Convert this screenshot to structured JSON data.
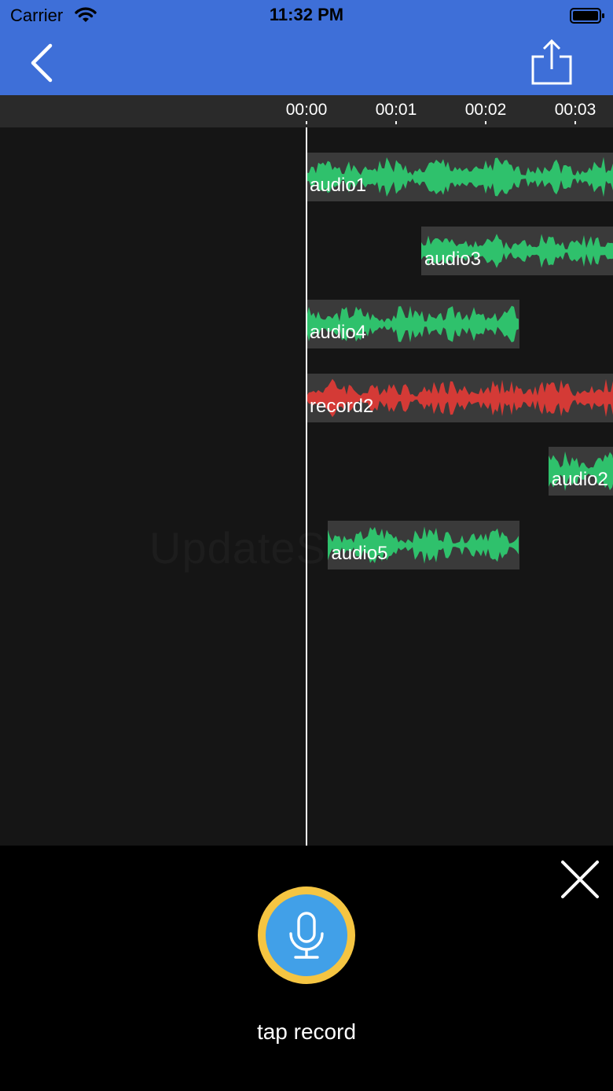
{
  "status_bar": {
    "carrier": "Carrier",
    "time": "11:32 PM",
    "wifi_icon": "wifi-icon",
    "battery_icon": "battery-icon"
  },
  "nav": {
    "back_icon": "chevron-left-icon",
    "share_icon": "share-icon",
    "background_color": "#3e6fd8"
  },
  "ruler": {
    "labels": [
      "00:00",
      "00:01",
      "00:02",
      "00:03"
    ]
  },
  "tracks": [
    {
      "label": "audio1",
      "color": "#2fc16c",
      "start_sec": 0.0,
      "duration_sec": 3.5
    },
    {
      "label": "audio3",
      "color": "#2fc16c",
      "start_sec": 1.28,
      "duration_sec": 2.3
    },
    {
      "label": "audio4",
      "color": "#2fc16c",
      "start_sec": 0.0,
      "duration_sec": 2.38
    },
    {
      "label": "record2",
      "color": "#d43a36",
      "start_sec": 0.0,
      "duration_sec": 3.5
    },
    {
      "label": "audio2",
      "color": "#2fc16c",
      "start_sec": 2.7,
      "duration_sec": 1.0
    },
    {
      "label": "audio5",
      "color": "#2fc16c",
      "start_sec": 0.24,
      "duration_sec": 2.14
    }
  ],
  "watermark": "UpdateStar.com",
  "bottom_panel": {
    "close_icon": "close-icon",
    "record_icon": "microphone-icon",
    "record_label": "tap record",
    "ring_color": "#f5c542",
    "button_color": "#41a0e8"
  }
}
